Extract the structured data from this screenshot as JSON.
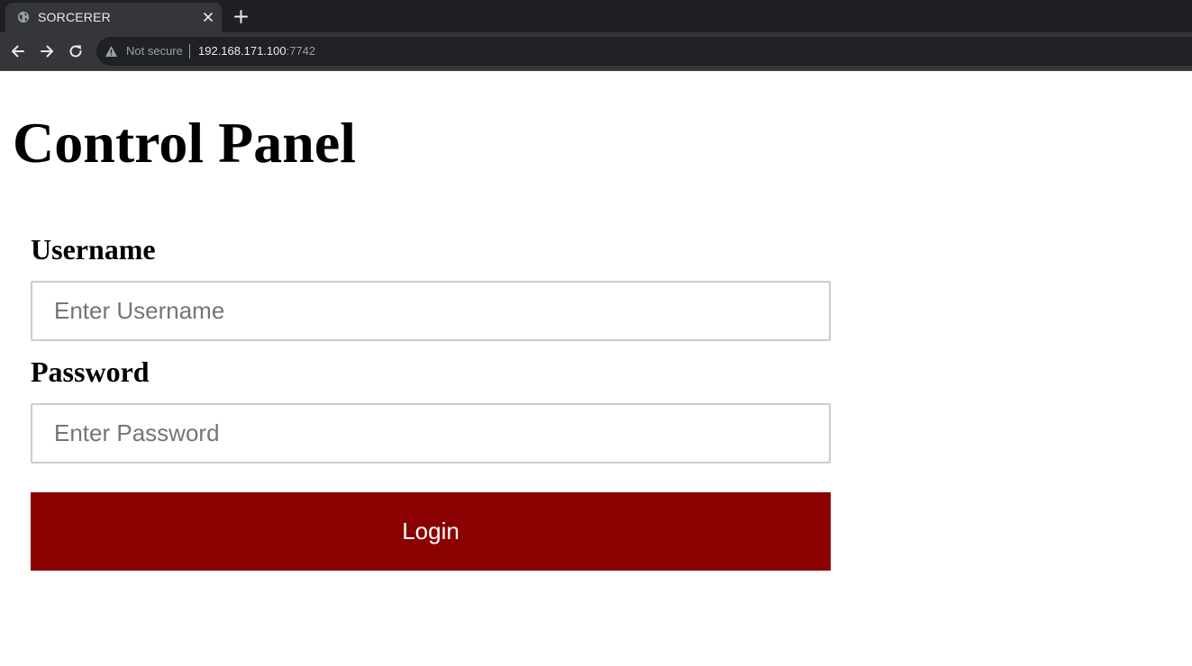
{
  "browser": {
    "tab_title": "SORCERER",
    "security_label": "Not secure",
    "url_host": "192.168.171.100",
    "url_port": ":7742",
    "icons": {
      "favicon": "globe-icon",
      "close": "close-icon",
      "new_tab": "plus-icon",
      "back": "arrow-left-icon",
      "forward": "arrow-right-icon",
      "reload": "reload-icon",
      "warning": "warning-icon"
    }
  },
  "page": {
    "title": "Control Panel",
    "username_label": "Username",
    "username_placeholder": "Enter Username",
    "username_value": "",
    "password_label": "Password",
    "password_placeholder": "Enter Password",
    "password_value": "",
    "login_label": "Login"
  },
  "colors": {
    "login_button": "#8b0000",
    "chrome_dark": "#1f2023",
    "chrome_toolbar": "#35363a",
    "omnibox": "#202124"
  }
}
